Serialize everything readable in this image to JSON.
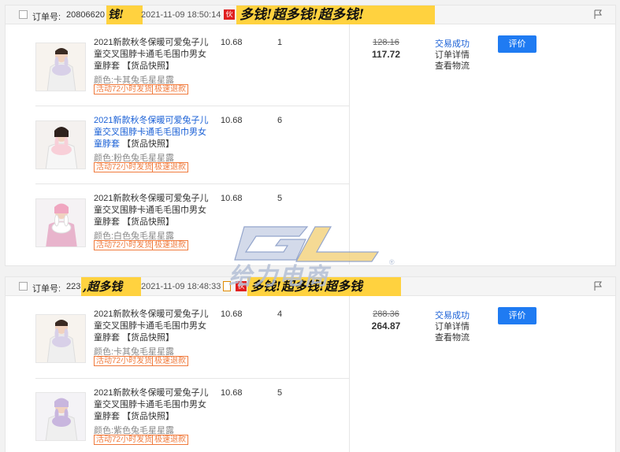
{
  "orders": [
    {
      "order_no_label": "订单号:",
      "order_no_value": "20806620",
      "time": "2021-11-09 18:50:14",
      "shop_badge": "伙",
      "sticker_text": "钱!",
      "banner_text": "多钱!超多钱!超多钱!",
      "items": [
        {
          "title": "2021新款秋冬保暖可爱兔子儿童交叉围脖卡通毛毛围巾男女童脖套",
          "snapshot": "【货品快照】",
          "color": "颜色:卡其兔毛星星露",
          "price": "10.68",
          "qty": "1",
          "tags": [
            "活动72小时发货",
            "极速退款"
          ]
        },
        {
          "title": "2021新款秋冬保暖可爱兔子儿童交叉围脖卡通毛毛围巾男女童脖套",
          "snapshot": "【货品快照】",
          "color": "颜色:粉色兔毛星星露",
          "price": "10.68",
          "qty": "6",
          "tags": [
            "活动72小时发货",
            "极速退款"
          ]
        },
        {
          "title": "2021新款秋冬保暖可爱兔子儿童交叉围脖卡通毛毛围巾男女童脖套",
          "snapshot": "【货品快照】",
          "color": "颜色:白色兔毛星星露",
          "price": "10.68",
          "qty": "5",
          "tags": [
            "活动72小时发货",
            "极速退款"
          ]
        }
      ],
      "original_total": "128.16",
      "total": "117.72",
      "status": "交易成功",
      "detail_link": "订单详情",
      "logistics_link": "查看物流",
      "rate_button": "评价"
    },
    {
      "order_no_label": "订单号:",
      "order_no_value": "2237",
      "time": "2021-11-09 18:48:33",
      "shop_badge": "伙",
      "sticker_text": ",超多钱",
      "banner_text": "多钱!超多钱!超多钱",
      "items": [
        {
          "title": "2021新款秋冬保暖可爱兔子儿童交叉围脖卡通毛毛围巾男女童脖套",
          "snapshot": "【货品快照】",
          "color": "颜色:卡其兔毛星星露",
          "price": "10.68",
          "qty": "4",
          "tags": [
            "活动72小时发货",
            "极速退款"
          ]
        },
        {
          "title": "2021新款秋冬保暖可爱兔子儿童交叉围脖卡通毛毛围巾男女童脖套",
          "snapshot": "【货品快照】",
          "color": "颜色:紫色兔毛星星露",
          "price": "10.68",
          "qty": "5",
          "tags": [
            "活动72小时发货",
            "极速退款"
          ]
        }
      ],
      "original_total": "288.36",
      "total": "264.87",
      "status": "交易成功",
      "detail_link": "订单详情",
      "logistics_link": "查看物流",
      "rate_button": "评价"
    }
  ],
  "watermark": {
    "brand": "给力电商",
    "mark": "®"
  },
  "colors": {
    "link": "#1a60d6",
    "button": "#1f7bf2",
    "tag": "#f07a3c",
    "sticker": "#ffd23f",
    "badge": "#e02020"
  },
  "icons": {
    "flag": "flag-icon",
    "checkbox": "checkbox-icon",
    "doc": "document-icon"
  }
}
